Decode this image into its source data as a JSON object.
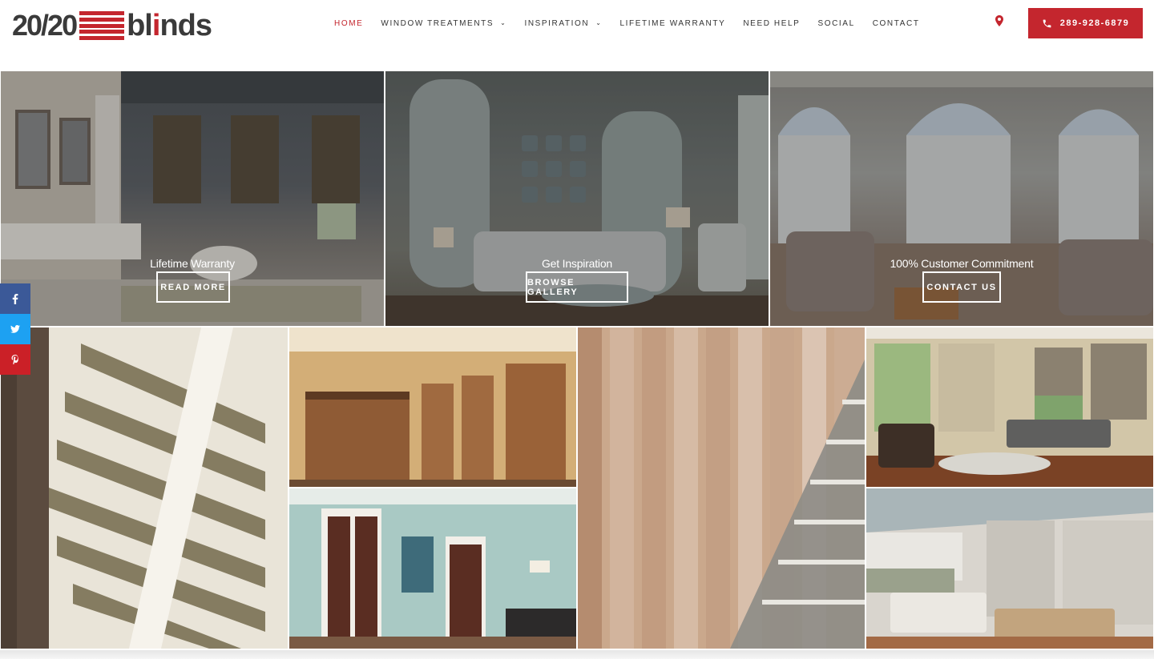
{
  "brand": {
    "num": "20/20",
    "word_pre": "bl",
    "word_i": "i",
    "word_post": "nds",
    "accent": "#c4262e"
  },
  "nav": {
    "items": [
      {
        "label": "HOME",
        "active": true
      },
      {
        "label": "WINDOW TREATMENTS",
        "dropdown": true
      },
      {
        "label": "INSPIRATION",
        "dropdown": true
      },
      {
        "label": "LIFETIME WARRANTY"
      },
      {
        "label": "NEED HELP"
      },
      {
        "label": "SOCIAL"
      },
      {
        "label": "CONTACT"
      }
    ],
    "location_icon": "map-pin-icon",
    "phone": "289-928-6879"
  },
  "hero_panels": [
    {
      "caption": "Lifetime Warranty",
      "button": "READ MORE"
    },
    {
      "caption": "Get Inspiration",
      "button": "BROWSE GALLERY"
    },
    {
      "caption": "100% Customer Commitment",
      "button": "CONTACT US"
    }
  ],
  "share": [
    {
      "icon": "facebook-icon",
      "color": "#3b5998"
    },
    {
      "icon": "twitter-icon",
      "color": "#1da1f2"
    },
    {
      "icon": "pinterest-icon",
      "color": "#cb2027"
    }
  ]
}
